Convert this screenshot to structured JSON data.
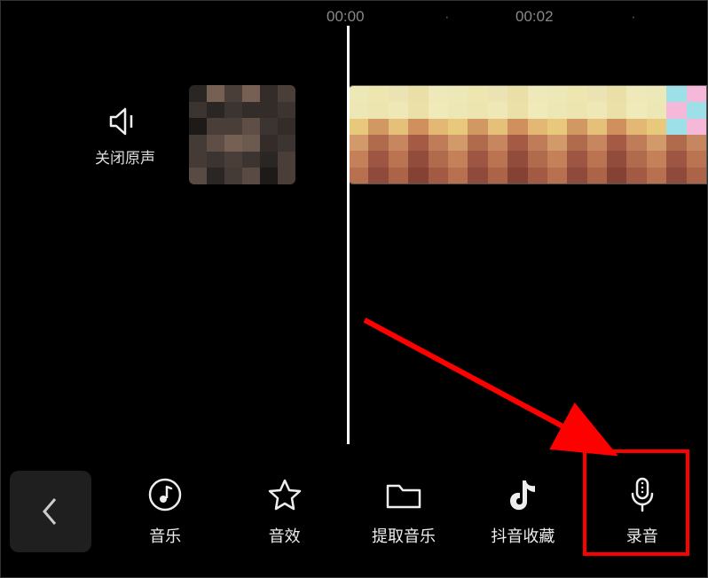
{
  "timeline": {
    "time_start": "00:00",
    "time_marker": "00:02"
  },
  "mute": {
    "label": "关闭原声"
  },
  "toolbar": {
    "music": "音乐",
    "sfx": "音效",
    "extract": "提取音乐",
    "douyin_fav": "抖音收藏",
    "record": "录音"
  }
}
